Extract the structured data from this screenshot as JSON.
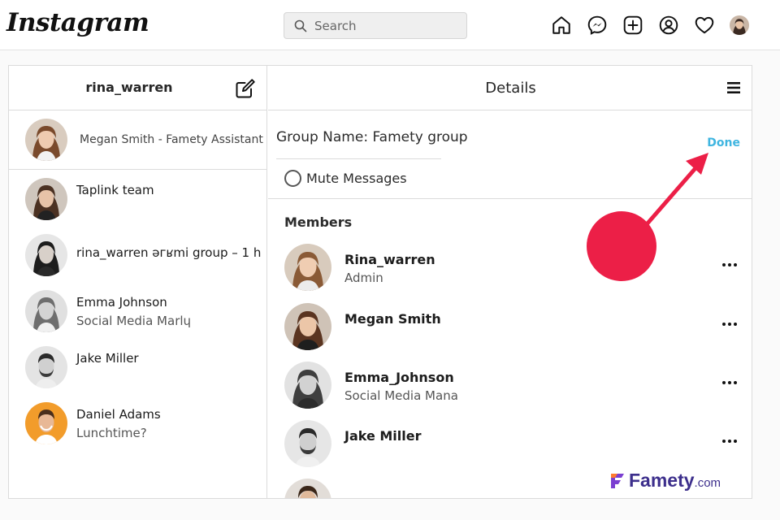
{
  "app": {
    "logo": "Instagram"
  },
  "search": {
    "placeholder": "Search"
  },
  "nav": [
    "home-icon",
    "messenger-icon",
    "new-post-icon",
    "profile-icon",
    "heart-icon",
    "avatar"
  ],
  "left": {
    "username": "rina_warren",
    "pinned": {
      "text": "Megan Smith - Famety Assistant"
    },
    "chats": [
      {
        "name": "Taplink team",
        "sub": ""
      },
      {
        "name": "rina_warren əгʁmi group – 1 h",
        "sub": ""
      },
      {
        "name": "Emma Johnson",
        "sub": "Social Media Marlɥ"
      },
      {
        "name": "Jake Miller",
        "sub": ""
      },
      {
        "name": "Daniel Adams",
        "sub": "Lunchtime?"
      }
    ]
  },
  "details": {
    "title": "Details",
    "group_name": "Group Name: Famety group",
    "done_label": "Done",
    "mute_label": "Mute Messages",
    "members_title": "Members",
    "members": [
      {
        "name": "Rina_warren",
        "role": "Admin"
      },
      {
        "name": "Megan Smith",
        "role": ""
      },
      {
        "name": "Emma_Johnson",
        "role": "Social Media Mana"
      },
      {
        "name": "Jake Miller",
        "role": ""
      }
    ]
  },
  "watermark": {
    "brand": "Famety",
    "domain": ".com"
  },
  "colors": {
    "accent": "#3fb5e0",
    "annotation": "#ec1f47",
    "brand": "#3d2f8c"
  }
}
